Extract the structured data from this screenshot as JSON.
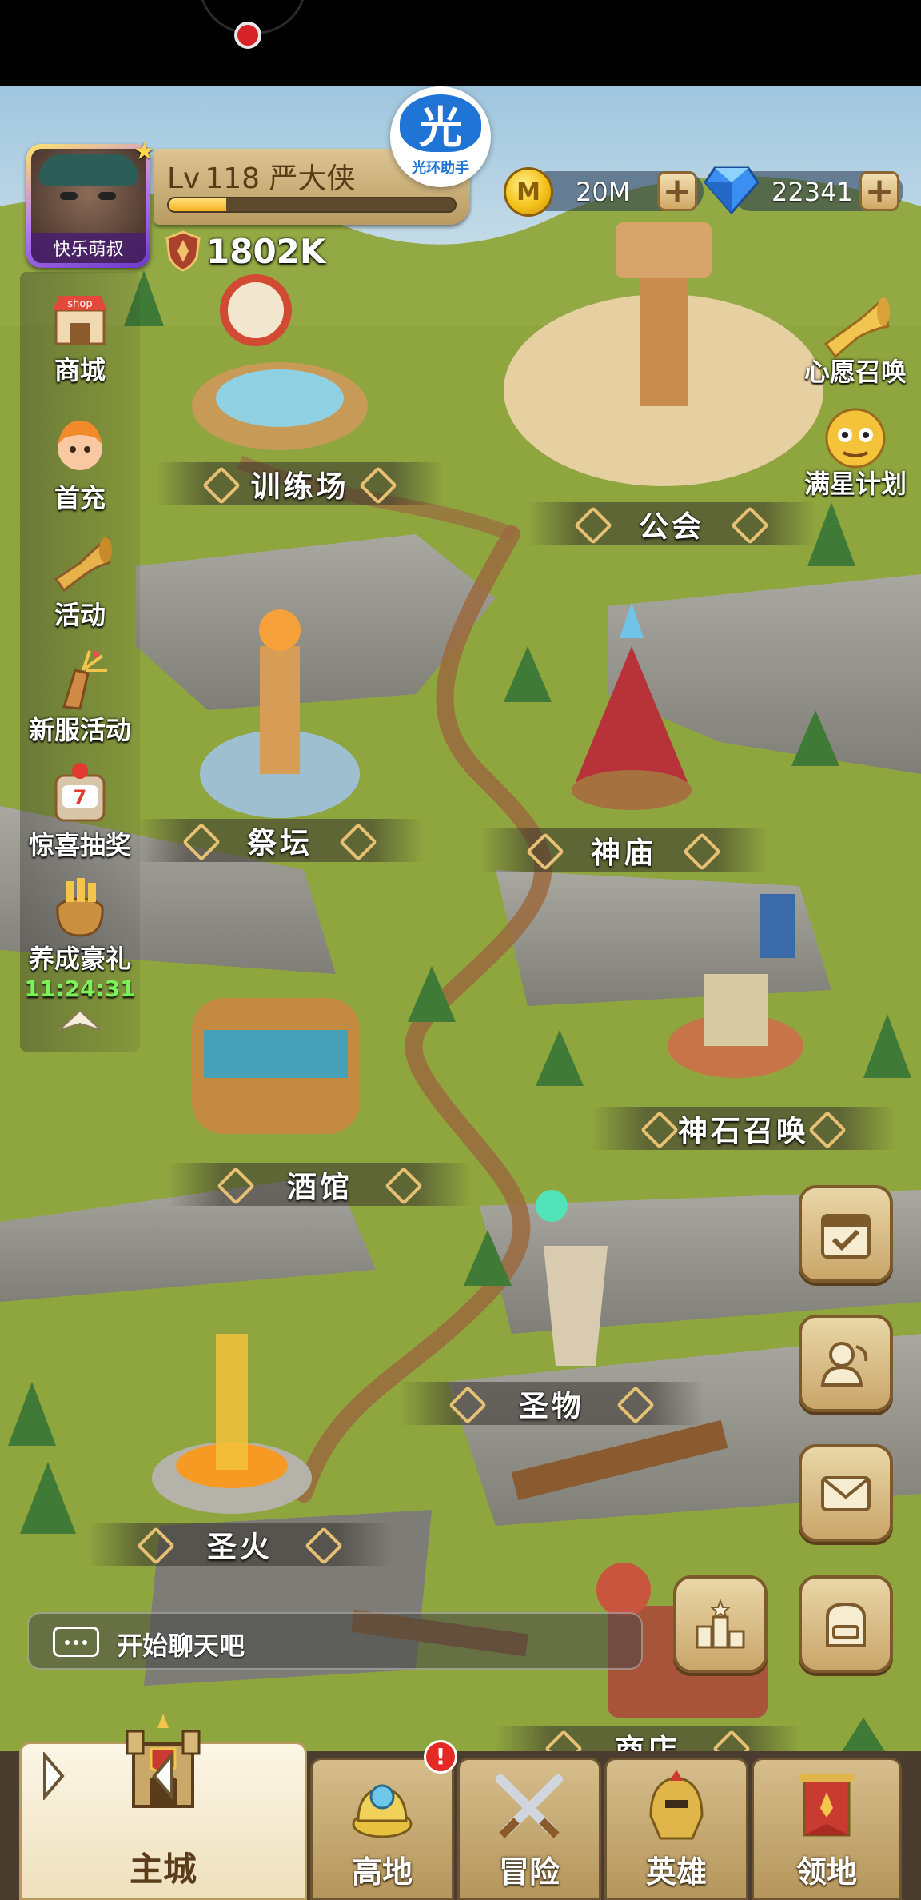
{
  "player": {
    "level_prefix": "Lv",
    "level": "118",
    "name": "严大侠",
    "avatar_tag": "快乐萌叔",
    "power": "1802K",
    "xp_fraction": 0.2
  },
  "helper_badge": {
    "glyph": "光",
    "text": "光环助手"
  },
  "currency": {
    "gold": {
      "icon": "gold-coin-icon",
      "value": "20M"
    },
    "diamond": {
      "icon": "diamond-icon",
      "value": "22341"
    }
  },
  "side_menu": [
    {
      "id": "shop",
      "label": "商城",
      "icon": "shop-icon",
      "icon_text": "shop"
    },
    {
      "id": "first-recharge",
      "label": "首充",
      "icon": "hero-portrait-icon"
    },
    {
      "id": "events",
      "label": "活动",
      "icon": "horn-icon"
    },
    {
      "id": "new-server",
      "label": "新服活动",
      "icon": "firework-icon"
    },
    {
      "id": "lottery",
      "label": "惊喜抽奖",
      "icon": "slot-machine-icon",
      "icon_text": "7"
    },
    {
      "id": "growth-gift",
      "label": "养成豪礼",
      "icon": "gift-bag-icon"
    }
  ],
  "side_timer": "11:24:31",
  "right_menu": [
    {
      "id": "wish-summon",
      "label": "心愿召唤",
      "icon": "horn-summon-icon"
    },
    {
      "id": "star-plan",
      "label": "满星计划",
      "icon": "yellow-creature-icon"
    }
  ],
  "buildings": [
    {
      "id": "training",
      "label": "训练场"
    },
    {
      "id": "guild",
      "label": "公会"
    },
    {
      "id": "altar",
      "label": "祭坛"
    },
    {
      "id": "temple",
      "label": "神庙"
    },
    {
      "id": "stone-summon",
      "label": "神石召唤"
    },
    {
      "id": "tavern",
      "label": "酒馆"
    },
    {
      "id": "relic",
      "label": "圣物"
    },
    {
      "id": "sacred-fire",
      "label": "圣火"
    },
    {
      "id": "shop-building",
      "label": "商店"
    }
  ],
  "action_buttons": [
    {
      "id": "checkin",
      "icon": "calendar-check-icon"
    },
    {
      "id": "friends",
      "icon": "friends-icon"
    },
    {
      "id": "mail",
      "icon": "mail-icon"
    },
    {
      "id": "ranking",
      "icon": "podium-icon"
    },
    {
      "id": "backpack",
      "icon": "backpack-icon"
    }
  ],
  "chat": {
    "placeholder": "开始聊天吧",
    "icon": "chat-bubble-icon"
  },
  "bottom_nav": [
    {
      "id": "main-city",
      "label": "主城",
      "icon": "castle-icon",
      "active": true
    },
    {
      "id": "highland",
      "label": "高地",
      "icon": "highland-icon",
      "badge": "!"
    },
    {
      "id": "adventure",
      "label": "冒险",
      "icon": "crossed-swords-icon"
    },
    {
      "id": "heroes",
      "label": "英雄",
      "icon": "helmet-icon"
    },
    {
      "id": "territory",
      "label": "领地",
      "icon": "banner-icon"
    }
  ],
  "colors": {
    "grass": "#8fa53e",
    "cliff": "#9a9a92",
    "path": "#9b6a3e",
    "label_orn": "#e6c073",
    "timer": "#7cf25a",
    "badge": "#e42a22"
  }
}
